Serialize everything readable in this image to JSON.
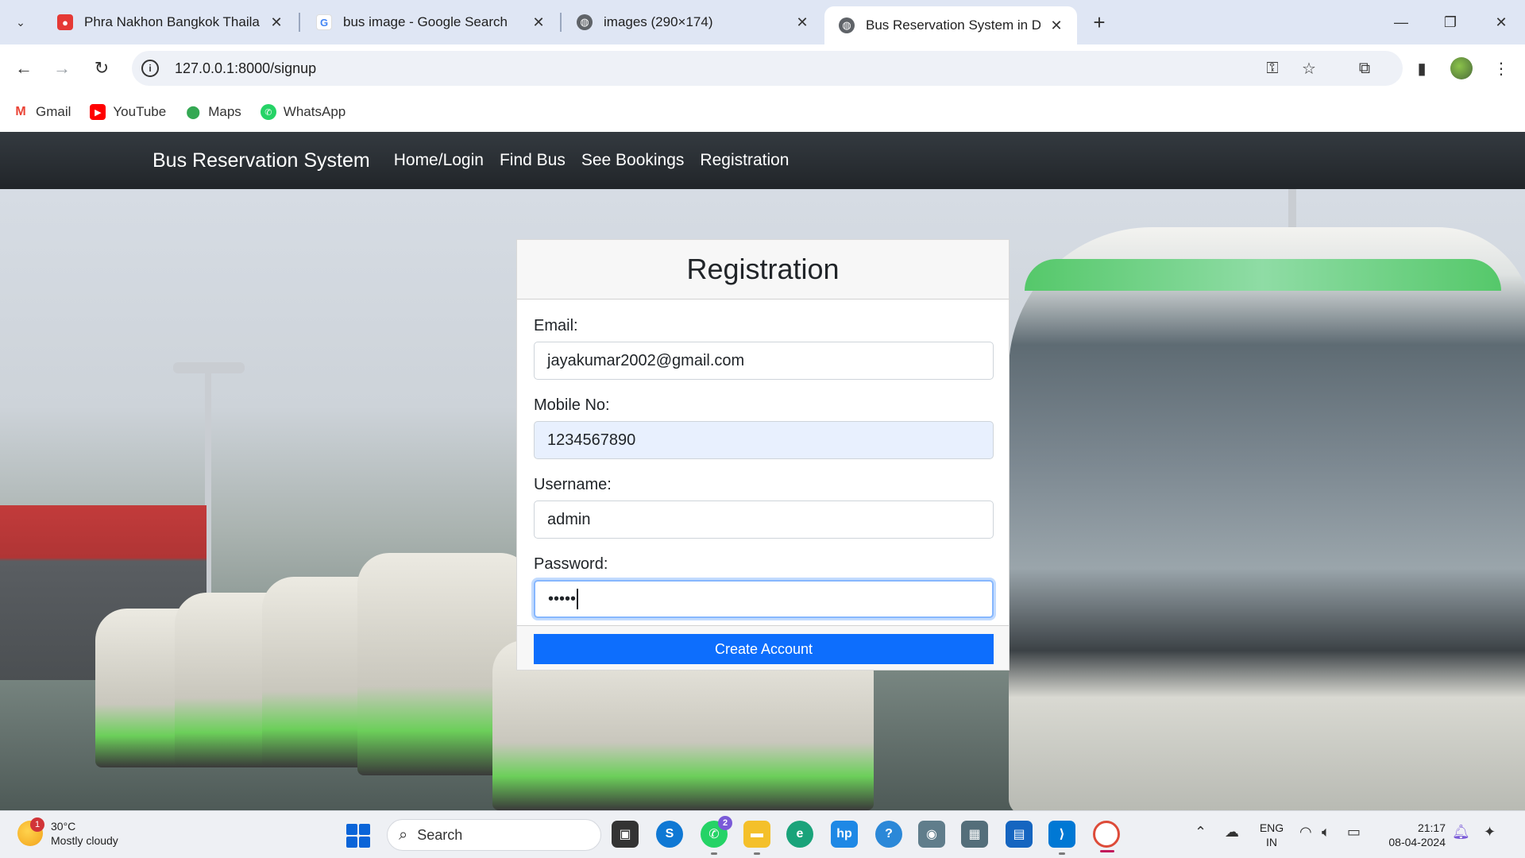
{
  "browser": {
    "tabs": [
      {
        "title": "Phra Nakhon Bangkok Thailand",
        "favicon": "red-pin-icon",
        "active": false
      },
      {
        "title": "bus image - Google Search",
        "favicon": "google-icon",
        "active": false
      },
      {
        "title": "images (290×174)",
        "favicon": "globe-icon",
        "active": false
      },
      {
        "title": "Bus Reservation System in Djan",
        "favicon": "globe-icon",
        "active": true
      }
    ],
    "url": "127.0.0.1:8000/signup",
    "bookmarks": [
      {
        "label": "Gmail",
        "icon": "gmail-icon",
        "color": "#ea4335"
      },
      {
        "label": "YouTube",
        "icon": "youtube-icon",
        "color": "#ff0000"
      },
      {
        "label": "Maps",
        "icon": "maps-icon",
        "color": "#34a853"
      },
      {
        "label": "WhatsApp",
        "icon": "whatsapp-icon",
        "color": "#25d366"
      }
    ]
  },
  "navbar": {
    "brand": "Bus Reservation System",
    "links": [
      "Home/Login",
      "Find Bus",
      "See Bookings",
      "Registration"
    ]
  },
  "form": {
    "title": "Registration",
    "email_label": "Email:",
    "email_value": "jayakumar2002@gmail.com",
    "mobile_label": "Mobile No:",
    "mobile_value": "1234567890",
    "username_label": "Username:",
    "username_value": "admin",
    "password_label": "Password:",
    "password_value": "•••••",
    "submit_label": "Create Account",
    "accent": "#0d6efd"
  },
  "taskbar": {
    "weather_temp": "30°C",
    "weather_desc": "Mostly cloudy",
    "weather_badge": "1",
    "search_label": "Search",
    "whatsapp_badge": "2",
    "lang_top": "ENG",
    "lang_bottom": "IN",
    "time": "21:17",
    "date": "08-04-2024"
  }
}
